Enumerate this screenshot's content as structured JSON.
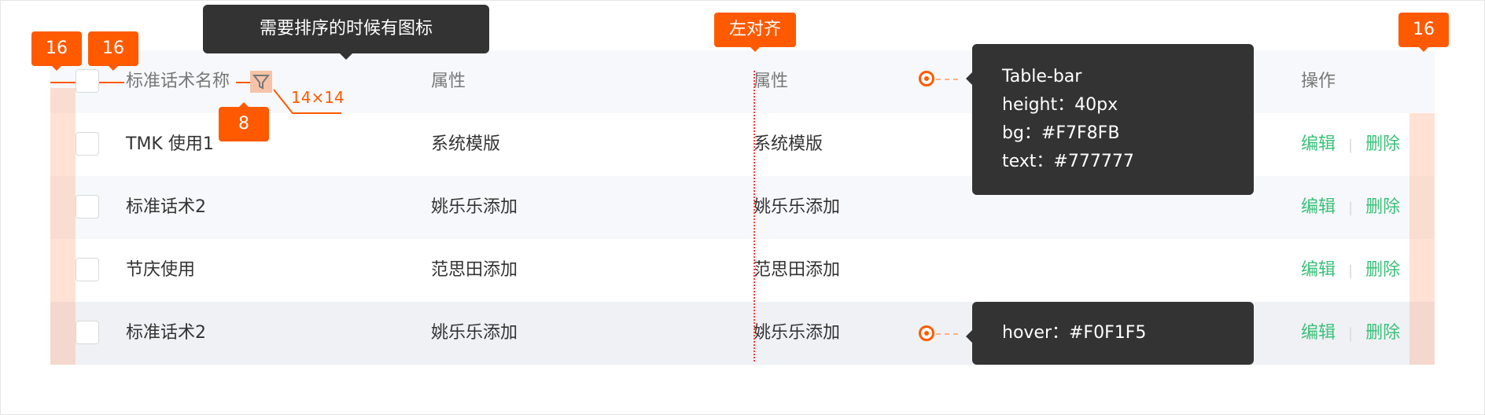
{
  "table": {
    "headers": [
      "标准话术名称",
      "属性",
      "属性",
      "操作"
    ],
    "rows": [
      {
        "name": "TMK 使用1",
        "attr1": "系统模版",
        "attr2": "系统模版"
      },
      {
        "name": "标准话术2",
        "attr1": "姚乐乐添加",
        "attr2": "姚乐乐添加"
      },
      {
        "name": "节庆使用",
        "attr1": "范思田添加",
        "attr2": "范思田添加"
      },
      {
        "name": "标准话术2",
        "attr1": "姚乐乐添加",
        "attr2": "姚乐乐添加"
      }
    ],
    "actions": {
      "edit": "编辑",
      "delete": "删除",
      "separator": "|"
    }
  },
  "annotations": {
    "pad_left_1": "16",
    "pad_left_2": "16",
    "pad_right": "16",
    "filter_gap": "8",
    "icon_size": "14×14",
    "sort_tip": "需要排序的时候有图标",
    "align_tip": "左对齐",
    "bar_tip": [
      "Table-bar",
      "height：40px",
      "bg：#F7F8FB",
      "text：#777777"
    ],
    "hover_tip": "hover：#F0F1F5"
  },
  "colors": {
    "header_bg": "#F7F8FB",
    "header_text": "#777777",
    "hover_bg": "#F0F1F5",
    "accent": "#ff5a00",
    "action": "#3cc07a"
  },
  "icons": [
    "filter-icon",
    "target-icon"
  ]
}
